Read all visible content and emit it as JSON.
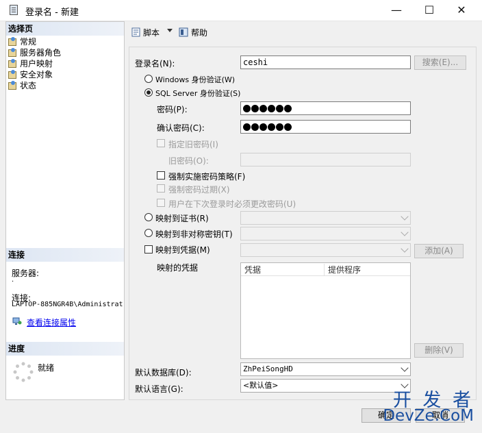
{
  "window": {
    "title": "登录名 - 新建",
    "minimize": "—",
    "maximize": "☐",
    "close": "✕"
  },
  "left": {
    "select_page_header": "选择页",
    "pages": [
      {
        "label": "常规"
      },
      {
        "label": "服务器角色"
      },
      {
        "label": "用户映射"
      },
      {
        "label": "安全对象"
      },
      {
        "label": "状态"
      }
    ],
    "connection_header": "连接",
    "server_label": "服务器:",
    "server_value": ".",
    "connection_label": "连接:",
    "connection_value": "LAPTOP-885NGR4B\\Administrat",
    "view_props_link": "查看连接属性",
    "progress_header": "进度",
    "progress_status": "就绪"
  },
  "toolbar": {
    "script_label": "脚本",
    "help_label": "帮助"
  },
  "form": {
    "login_name_label": "登录名(N):",
    "login_name_value": "ceshi",
    "search_button": "搜索(E)...",
    "windows_auth_label": "Windows 身份验证(W)",
    "sql_auth_label": "SQL Server 身份验证(S)",
    "password_label": "密码(P):",
    "confirm_password_label": "确认密码(C):",
    "password_dots": 6,
    "confirm_dots": 6,
    "specify_old_password_label": "指定旧密码(I)",
    "old_password_label": "旧密码(O):",
    "enforce_policy_label": "强制实施密码策略(F)",
    "enforce_expiration_label": "强制密码过期(X)",
    "must_change_label": "用户在下次登录时必须更改密码(U)",
    "map_cert_label": "映射到证书(R)",
    "map_asym_label": "映射到非对称密钥(T)",
    "map_credential_label": "映射到凭据(M)",
    "add_button": "添加(A)",
    "mapped_credentials_label": "映射的凭据",
    "grid_col_credential": "凭据",
    "grid_col_provider": "提供程序",
    "remove_button": "删除(V)",
    "default_db_label": "默认数据库(D):",
    "default_db_value": "ZhPeiSongHD",
    "default_lang_label": "默认语言(G):",
    "default_lang_value": "<默认值>"
  },
  "footer": {
    "ok_button": "确定",
    "cancel_button": "取消"
  },
  "watermark": {
    "line1": "开 发 者",
    "line2": "DevZe.CoM"
  },
  "colors": {
    "section_header": "#dde6f3",
    "link": "#0000ee",
    "watermark": "#1a4fa0"
  }
}
